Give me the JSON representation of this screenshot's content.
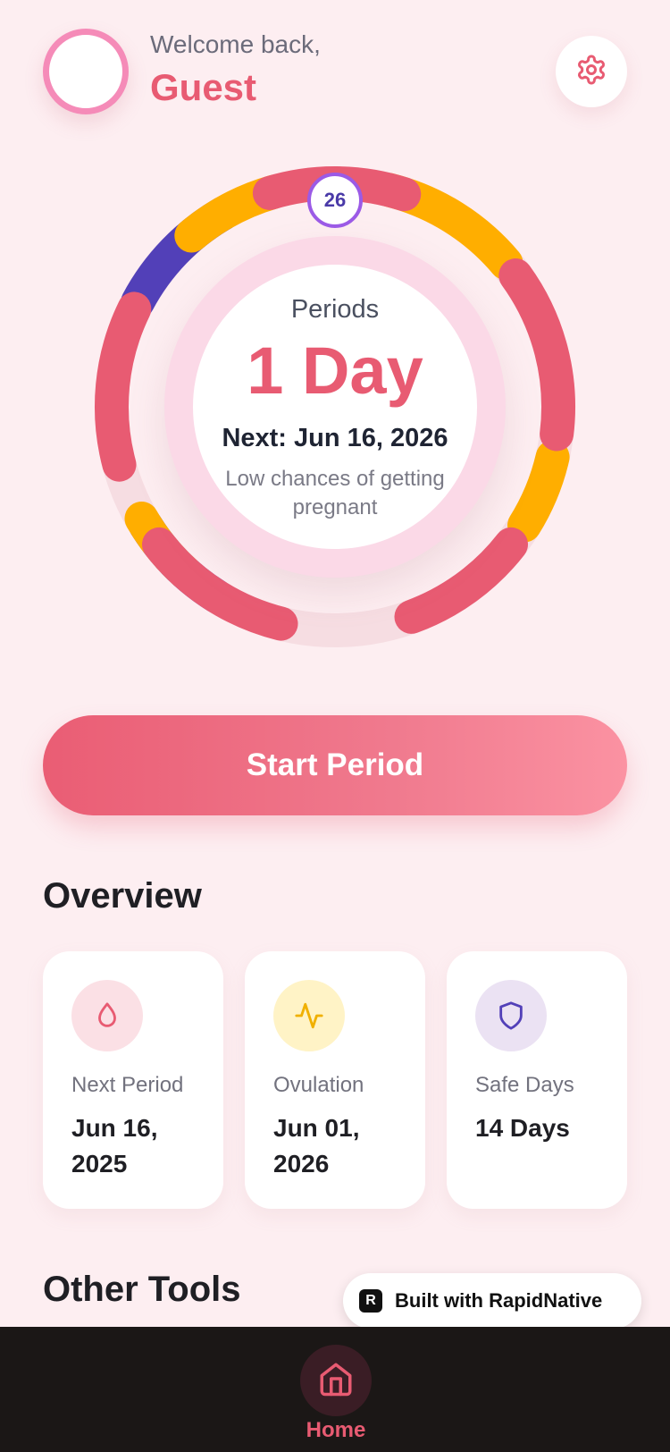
{
  "header": {
    "welcome_text": "Welcome back,",
    "user_name": "Guest",
    "settings_icon": "gear-icon"
  },
  "cycle": {
    "phase_label": "Periods",
    "phase_value": "1 Day",
    "next_text": "Next: Jun 16, 2026",
    "fertility_text": "Low chances of getting pregnant",
    "current_day": "26",
    "colors": {
      "period": "#e85b72",
      "fertile": "#ffae00",
      "ovulation": "#5240b8",
      "track": "#f6dde2"
    }
  },
  "start_button": {
    "label": "Start Period"
  },
  "overview": {
    "title": "Overview",
    "cards": [
      {
        "icon": "droplet-icon",
        "label": "Next Period",
        "value": "Jun 16, 2025",
        "accent": "#e85b72",
        "icon_bg": "#fbe0e5"
      },
      {
        "icon": "activity-icon",
        "label": "Ovulation",
        "value": "Jun 01, 2026",
        "accent": "#f0b000",
        "icon_bg": "#fff3c6"
      },
      {
        "icon": "shield-icon",
        "label": "Safe Days",
        "value": "14 Days",
        "accent": "#5240b8",
        "icon_bg": "#ebe2f3"
      }
    ]
  },
  "other_tools": {
    "title": "Other Tools"
  },
  "built_badge": {
    "label": "Built with RapidNative",
    "logo_letter": "R"
  },
  "bottom_nav": {
    "home_label": "Home",
    "home_icon": "home-icon"
  }
}
